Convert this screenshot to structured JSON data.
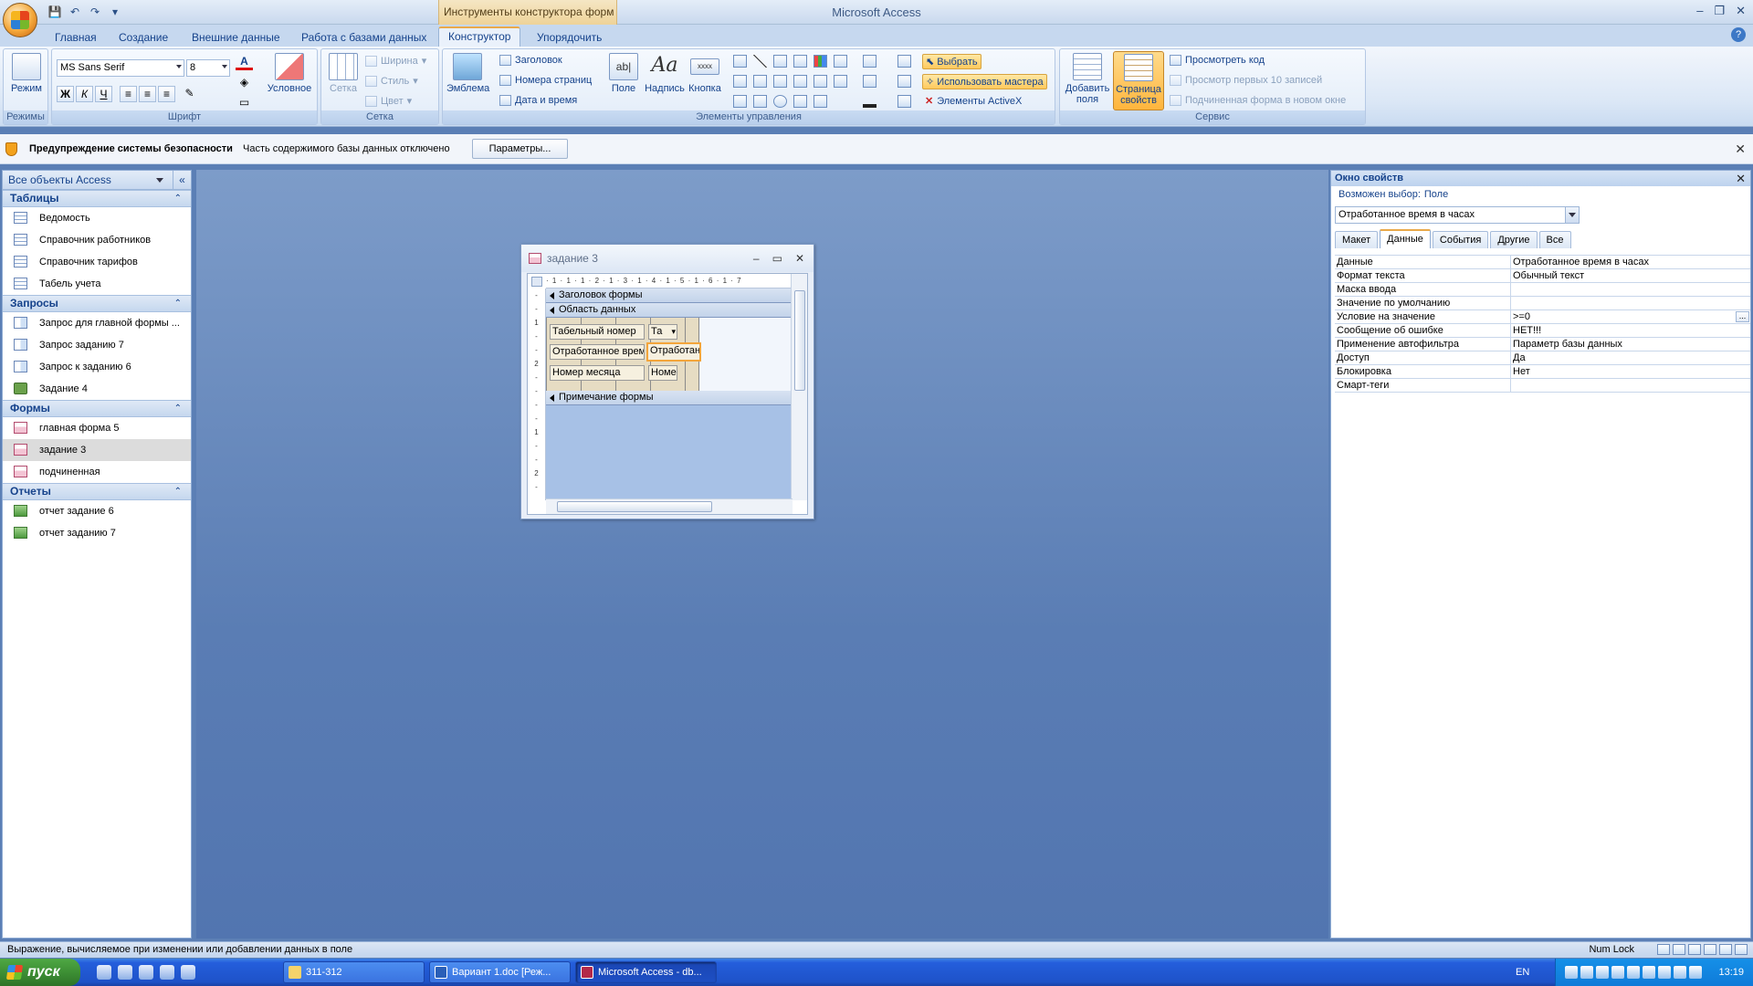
{
  "app": {
    "title": "Microsoft Access",
    "context_tools": "Инструменты конструктора форм",
    "accent": "#e9a94a"
  },
  "tabs": [
    {
      "label": "Главная"
    },
    {
      "label": "Создание"
    },
    {
      "label": "Внешние данные"
    },
    {
      "label": "Работа с базами данных"
    },
    {
      "label": "Конструктор",
      "active": true
    },
    {
      "label": "Упорядочить"
    }
  ],
  "ribbon": {
    "views": {
      "mode_label": "Режим",
      "group": "Режимы"
    },
    "font": {
      "face": "MS Sans Serif",
      "size": "8",
      "conditional": "Условное",
      "group": "Шрифт",
      "bold": "Ж",
      "italic": "К",
      "underline": "Ч"
    },
    "grid": {
      "grid_label": "Сетка",
      "width": "Ширина",
      "style": "Стиль",
      "color": "Цвет",
      "group": "Сетка"
    },
    "controls": {
      "logo": "Эмблема",
      "title": "Заголовок",
      "page_numbers": "Номера страниц",
      "date_time": "Дата и время",
      "field": "Поле",
      "label": "Надпись",
      "button": "Кнопка",
      "group": "Элементы управления",
      "select": "Выбрать",
      "use_wizards": "Использовать мастера",
      "activex": "Элементы ActiveX"
    },
    "tools": {
      "add_fields": "Добавить поля",
      "property_sheet": "Страница свойств",
      "view_code": "Просмотреть код",
      "view_top10": "Просмотр первых 10 записей",
      "subform_new": "Подчиненная форма в новом окне",
      "group": "Сервис"
    }
  },
  "security": {
    "title": "Предупреждение системы безопасности",
    "message": "Часть содержимого базы данных отключено",
    "options_button": "Параметры..."
  },
  "navpane": {
    "header": "Все объекты Access",
    "groups": [
      {
        "name": "Таблицы",
        "type": "table",
        "items": [
          "Ведомость",
          "Справочник работников",
          "Справочник тарифов",
          "Табель учета"
        ]
      },
      {
        "name": "Запросы",
        "type": "query",
        "items": [
          "Запрос для главной формы ...",
          "Запрос заданию 7",
          "Запрос к заданию 6",
          "Задание 4"
        ]
      },
      {
        "name": "Формы",
        "type": "form",
        "items": [
          "главная форма 5",
          "задание 3",
          "подчиненная"
        ],
        "selected": 1
      },
      {
        "name": "Отчеты",
        "type": "report",
        "items": [
          "отчет задание 6",
          "отчет заданию 7"
        ]
      }
    ]
  },
  "form_window": {
    "title": "задание 3",
    "ruler": "· 1 · 1 · 1 · 2 · 1 · 3 · 1 · 4 · 1 · 5 · 1 · 6 · 1 · 7",
    "sections": {
      "header": "Заголовок формы",
      "detail": "Область данных",
      "footer": "Примечание формы"
    },
    "controls": [
      {
        "label": "Табельный номер",
        "field": "Та"
      },
      {
        "label": "Отработанное врем",
        "field": "Отработанн"
      },
      {
        "label": "Номер месяца",
        "field": "Номе"
      }
    ]
  },
  "property_sheet": {
    "title": "Окно свойств",
    "selection_type_label": "Возможен выбор:",
    "selection_type": "Поле",
    "selected_object": "Отработанное время в часах",
    "tabs": [
      "Макет",
      "Данные",
      "События",
      "Другие",
      "Все"
    ],
    "active_tab": "Данные",
    "rows": [
      {
        "name": "Данные",
        "value": "Отработанное время в часах"
      },
      {
        "name": "Формат текста",
        "value": "Обычный текст"
      },
      {
        "name": "Маска ввода",
        "value": ""
      },
      {
        "name": "Значение по умолчанию",
        "value": ""
      },
      {
        "name": "Условие на значение",
        "value": ">=0",
        "builder": true
      },
      {
        "name": "Сообщение об ошибке",
        "value": "НЕТ!!!"
      },
      {
        "name": "Применение автофильтра",
        "value": "Параметр базы данных"
      },
      {
        "name": "Доступ",
        "value": "Да"
      },
      {
        "name": "Блокировка",
        "value": "Нет"
      },
      {
        "name": "Смарт-теги",
        "value": ""
      }
    ]
  },
  "statusbar": {
    "text": "Выражение, вычисляемое при изменении или добавлении данных в поле",
    "numlock": "Num Lock"
  },
  "taskbar": {
    "start": "пуск",
    "tasks": [
      {
        "label": "311-312"
      },
      {
        "label": "Вариант 1.doc [Реж..."
      },
      {
        "label": "Microsoft Access - db...",
        "active": true
      }
    ],
    "lang": "EN",
    "clock": "13:19"
  }
}
